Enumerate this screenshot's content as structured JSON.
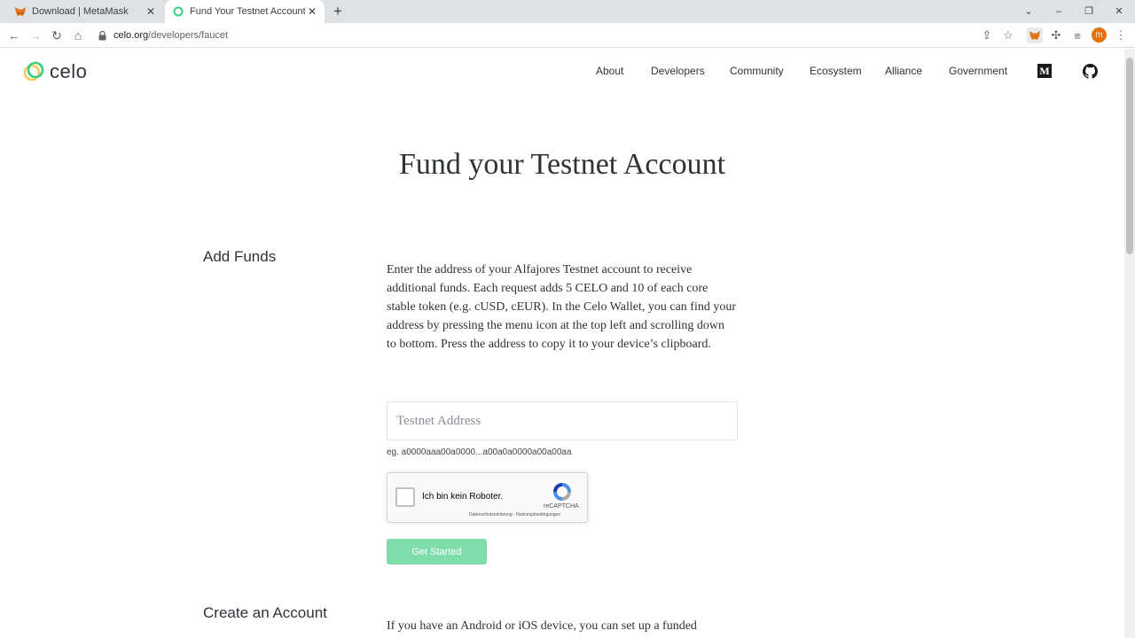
{
  "browser": {
    "tabs": [
      {
        "title": "Download | MetaMask",
        "active": false
      },
      {
        "title": "Fund Your Testnet Account",
        "active": true
      }
    ],
    "url_domain": "celo.org",
    "url_path": "/developers/faucet",
    "profile_initial": "m"
  },
  "site": {
    "logo_text": "celo",
    "nav": [
      "About",
      "Developers",
      "Community",
      "Ecosystem",
      "Alliance",
      "Government"
    ],
    "medium_label": "M"
  },
  "page": {
    "title": "Fund your Testnet Account",
    "add_funds": {
      "label": "Add Funds",
      "description": "Enter the address of your Alfajores Testnet account to receive additional funds. Each request adds 5 CELO and 10 of each core stable token (e.g. cUSD, cEUR). In the Celo Wallet, you can find your address by pressing the menu icon at the top left and scrolling down to bottom. Press the address to copy it to your device’s clipboard.",
      "input_placeholder": "Testnet Address",
      "input_hint": "eg. a0000aaa00a0000...a00a0a0000a00a00aa",
      "captcha_label": "Ich bin kein Roboter.",
      "captcha_brand": "reCAPTCHA",
      "captcha_links": "Datenschutzerklärung - Nutzungsbedingungen",
      "button_label": "Get Started"
    },
    "create_account": {
      "label": "Create an Account",
      "description": "If you have an Android or iOS device, you can set up a funded"
    }
  },
  "colors": {
    "accent_green": "#7fdcab",
    "celo_yellow": "#fbcc5c",
    "celo_green": "#35d07f",
    "text_dark": "#2e3338"
  }
}
